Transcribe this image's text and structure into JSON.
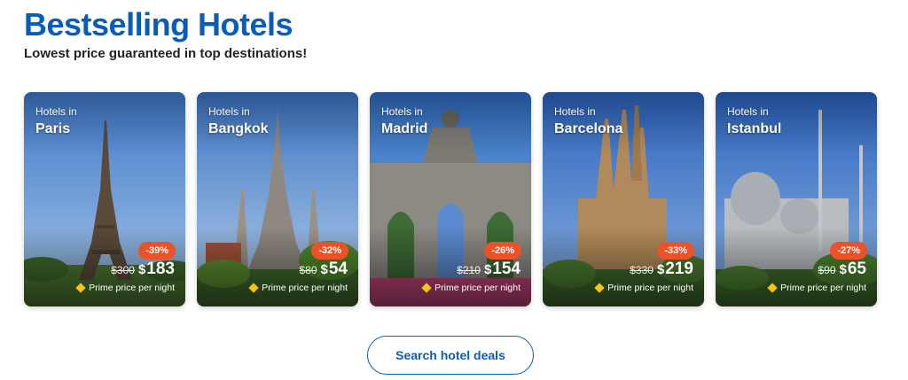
{
  "header": {
    "title": "Bestselling Hotels",
    "subtitle": "Lowest price guaranteed in top destinations!"
  },
  "cards": [
    {
      "hotels_in": "Hotels in",
      "city": "Paris",
      "discount": "-39%",
      "old_price": "$300",
      "currency": "$",
      "price": "183",
      "prime": "Prime price per night"
    },
    {
      "hotels_in": "Hotels in",
      "city": "Bangkok",
      "discount": "-32%",
      "old_price": "$80",
      "currency": "$",
      "price": "54",
      "prime": "Prime price per night"
    },
    {
      "hotels_in": "Hotels in",
      "city": "Madrid",
      "discount": "-26%",
      "old_price": "$210",
      "currency": "$",
      "price": "154",
      "prime": "Prime price per night"
    },
    {
      "hotels_in": "Hotels in",
      "city": "Barcelona",
      "discount": "-33%",
      "old_price": "$330",
      "currency": "$",
      "price": "219",
      "prime": "Prime price per night"
    },
    {
      "hotels_in": "Hotels in",
      "city": "Istanbul",
      "discount": "-27%",
      "old_price": "$90",
      "currency": "$",
      "price": "65",
      "prime": "Prime price per night"
    }
  ],
  "cta": {
    "label": "Search hotel deals"
  },
  "colors": {
    "brand": "#0a5cb8",
    "discount": "#e8532a",
    "prime_icon": "#f5c518"
  }
}
